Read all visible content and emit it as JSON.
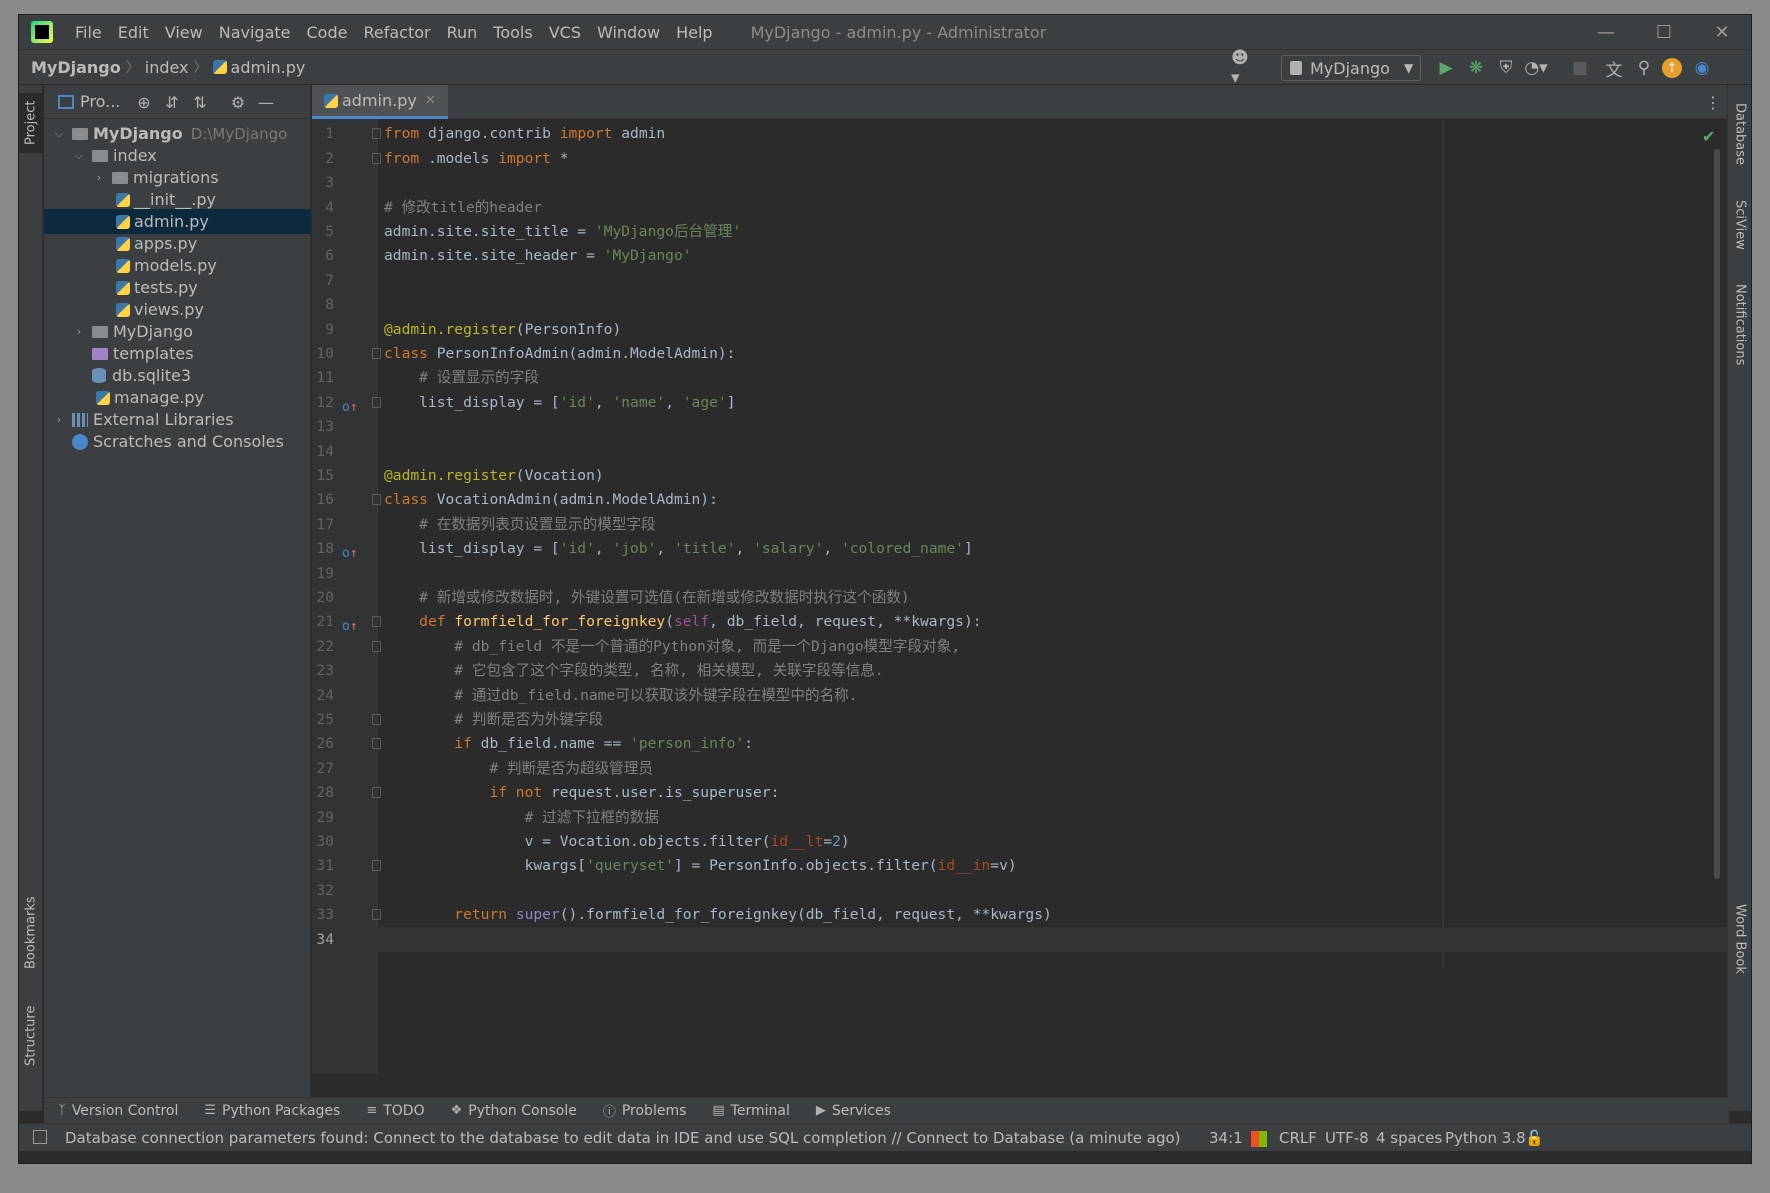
{
  "menu": [
    "File",
    "Edit",
    "View",
    "Navigate",
    "Code",
    "Refactor",
    "Run",
    "Tools",
    "VCS",
    "Window",
    "Help"
  ],
  "window_title": "MyDjango - admin.py - Administrator",
  "breadcrumb": [
    "MyDjango",
    "index",
    "admin.py"
  ],
  "run_config": "MyDjango",
  "project_panel": {
    "title": "Pro..."
  },
  "left_tabs": [
    "Project",
    "Bookmarks",
    "Structure"
  ],
  "right_tabs": [
    "Database",
    "SciView",
    "Notifications",
    "Word Book"
  ],
  "tree": [
    {
      "label": "MyDjango",
      "hint": "D:\\MyDjango"
    },
    {
      "label": "index"
    },
    {
      "label": "migrations"
    },
    {
      "label": "__init__.py"
    },
    {
      "label": "admin.py"
    },
    {
      "label": "apps.py"
    },
    {
      "label": "models.py"
    },
    {
      "label": "tests.py"
    },
    {
      "label": "views.py"
    },
    {
      "label": "MyDjango"
    },
    {
      "label": "templates"
    },
    {
      "label": "db.sqlite3"
    },
    {
      "label": "manage.py"
    },
    {
      "label": "External Libraries"
    },
    {
      "label": "Scratches and Consoles"
    }
  ],
  "editor_tab": "admin.py",
  "line_numbers": [
    "1",
    "2",
    "3",
    "4",
    "5",
    "6",
    "7",
    "8",
    "9",
    "10",
    "11",
    "12",
    "13",
    "14",
    "15",
    "16",
    "17",
    "18",
    "19",
    "20",
    "21",
    "22",
    "23",
    "24",
    "25",
    "26",
    "27",
    "28",
    "29",
    "30",
    "31",
    "32",
    "33",
    "34"
  ],
  "bottom_tabs": [
    "Version Control",
    "Python Packages",
    "TODO",
    "Python Console",
    "Problems",
    "Terminal",
    "Services"
  ],
  "status": {
    "message": "Database connection parameters found: Connect to the database to edit data in IDE and use SQL completion // Connect to Database (a minute ago)",
    "position": "34:1",
    "line_sep": "CRLF",
    "encoding": "UTF-8",
    "indent": "4 spaces",
    "interpreter": "Python 3.8"
  }
}
